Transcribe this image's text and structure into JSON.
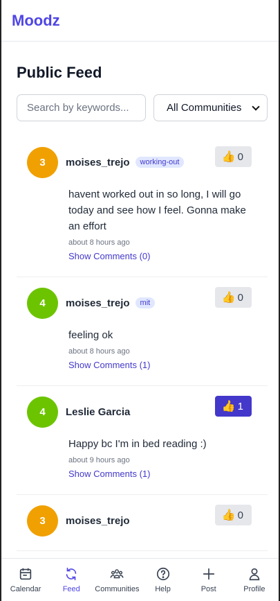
{
  "app": {
    "brand": "Moodz"
  },
  "page": {
    "title": "Public Feed"
  },
  "filters": {
    "search_placeholder": "Search by keywords...",
    "community_selected": "All Communities"
  },
  "posts": [
    {
      "mood": "3",
      "mood_color": "#f0a000",
      "username": "moises_trejo",
      "tag": "working-out",
      "likes": "0",
      "liked": false,
      "text": "havent worked out in so long, I will go today and see how I feel. Gonna make an effort",
      "time": "about 8 hours ago",
      "comments": "Show Comments (0)"
    },
    {
      "mood": "4",
      "mood_color": "#6cc400",
      "username": "moises_trejo",
      "tag": "mit",
      "likes": "0",
      "liked": false,
      "text": "feeling ok",
      "time": "about 8 hours ago",
      "comments": "Show Comments (1)"
    },
    {
      "mood": "4",
      "mood_color": "#6cc400",
      "username": "Leslie Garcia",
      "tag": "",
      "likes": "1",
      "liked": true,
      "text": "Happy bc I'm in bed reading :)",
      "time": "about 9 hours ago",
      "comments": "Show Comments (1)"
    },
    {
      "mood": "3",
      "mood_color": "#f0a000",
      "username": "moises_trejo",
      "tag": "",
      "likes": "0",
      "liked": false
    }
  ],
  "nav": {
    "items": [
      {
        "label": "Calendar",
        "icon": "calendar-icon"
      },
      {
        "label": "Feed",
        "icon": "refresh-icon",
        "active": true
      },
      {
        "label": "Communities",
        "icon": "people-icon"
      },
      {
        "label": "Help",
        "icon": "help-icon"
      },
      {
        "label": "Post",
        "icon": "plus-icon"
      },
      {
        "label": "Profile",
        "icon": "user-icon"
      }
    ]
  },
  "colors": {
    "accent": "#4f46e5",
    "like_active": "#4338ca"
  }
}
